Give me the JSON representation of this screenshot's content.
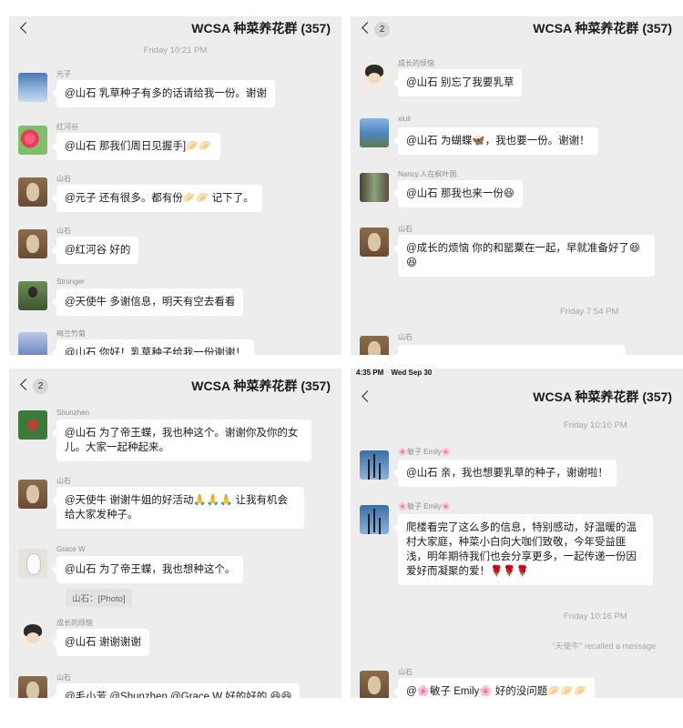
{
  "group_title": "WCSA 种菜养花群 (357)",
  "status_bar": {
    "time": "4:35 PM",
    "date": "Wed Sep 30"
  },
  "panel1": {
    "timestamp": "Friday 10:21 PM",
    "messages": [
      {
        "name": "元子",
        "text": "@山石 乳草种子有多的话请给我一份。谢谢"
      },
      {
        "name": "红河谷",
        "text": "@山石 那我们周日见握手]🥟🥟"
      },
      {
        "name": "山石",
        "text": "@元子 还有很多。都有份🥟🥟 记下了。"
      },
      {
        "name": "山石",
        "text": "@红河谷 好的"
      },
      {
        "name": "Stronger",
        "text": "@天使牛 多谢信息，明天有空去看看"
      },
      {
        "name": "梅兰竹菊",
        "text": "@山石 你好！乳草种子给我一份谢谢！"
      }
    ]
  },
  "panel2": {
    "badge": "2",
    "timestamp": "Friday 7:54 PM",
    "messages": [
      {
        "name": "成长的烦恼",
        "text": "@山石 别忘了我要乳草"
      },
      {
        "name": "xiuli",
        "text": "@山石 为蝴蝶🦋，我也要一份。谢谢！"
      },
      {
        "name": "Nancy.人在枫叶国.",
        "text": "@山石 那我也来一份😆"
      },
      {
        "name": "山石",
        "text": "@成长的烦恼 你的和罂粟在一起，早就准备好了😆😆"
      },
      {
        "name": "山石",
        "text": ""
      }
    ]
  },
  "panel3": {
    "badge": "2",
    "messages": [
      {
        "name": "Shunzhen",
        "text": "@山石 为了帝王蝶，我也种这个。谢谢你及你的女儿。大家一起种起来。"
      },
      {
        "name": "山石",
        "text": "@天使牛 谢谢牛姐的好活动🙏🙏🙏 让我有机会给大家发种子。"
      },
      {
        "name": "Grace W",
        "text": "@山石 为了帝王蝶，我也想种这个。",
        "quote": "山石：[Photo]"
      },
      {
        "name": "成长的烦恼",
        "text": "@山石 谢谢谢谢"
      },
      {
        "name": "山石",
        "text": "@毛小芳 @Shunzhen @Grace W 好的好的 😆😆"
      }
    ]
  },
  "panel4": {
    "timestamp1": "Friday 10:10 PM",
    "timestamp2": "Friday 10:16 PM",
    "recall": "\"天使牛\" recalled a message",
    "messages": [
      {
        "name": "🌸敏子 Emily🌸",
        "text": "@山石 亲，我也想要乳草的种子，谢谢啦！"
      },
      {
        "name": "🌸敏子 Emily🌸",
        "text": "爬楼看完了这么多的信息，特别感动，好温暖的温村大家庭，种菜小白向大咖们致敬，今年受益匪浅，明年期待我们也会分享更多，一起传递一份因爱好而凝聚的爱！🌹🌹🌹"
      },
      {
        "name": "山石",
        "text": "@🌸敏子 Emily🌸 好的没问题🥟🥟🥟"
      }
    ]
  }
}
